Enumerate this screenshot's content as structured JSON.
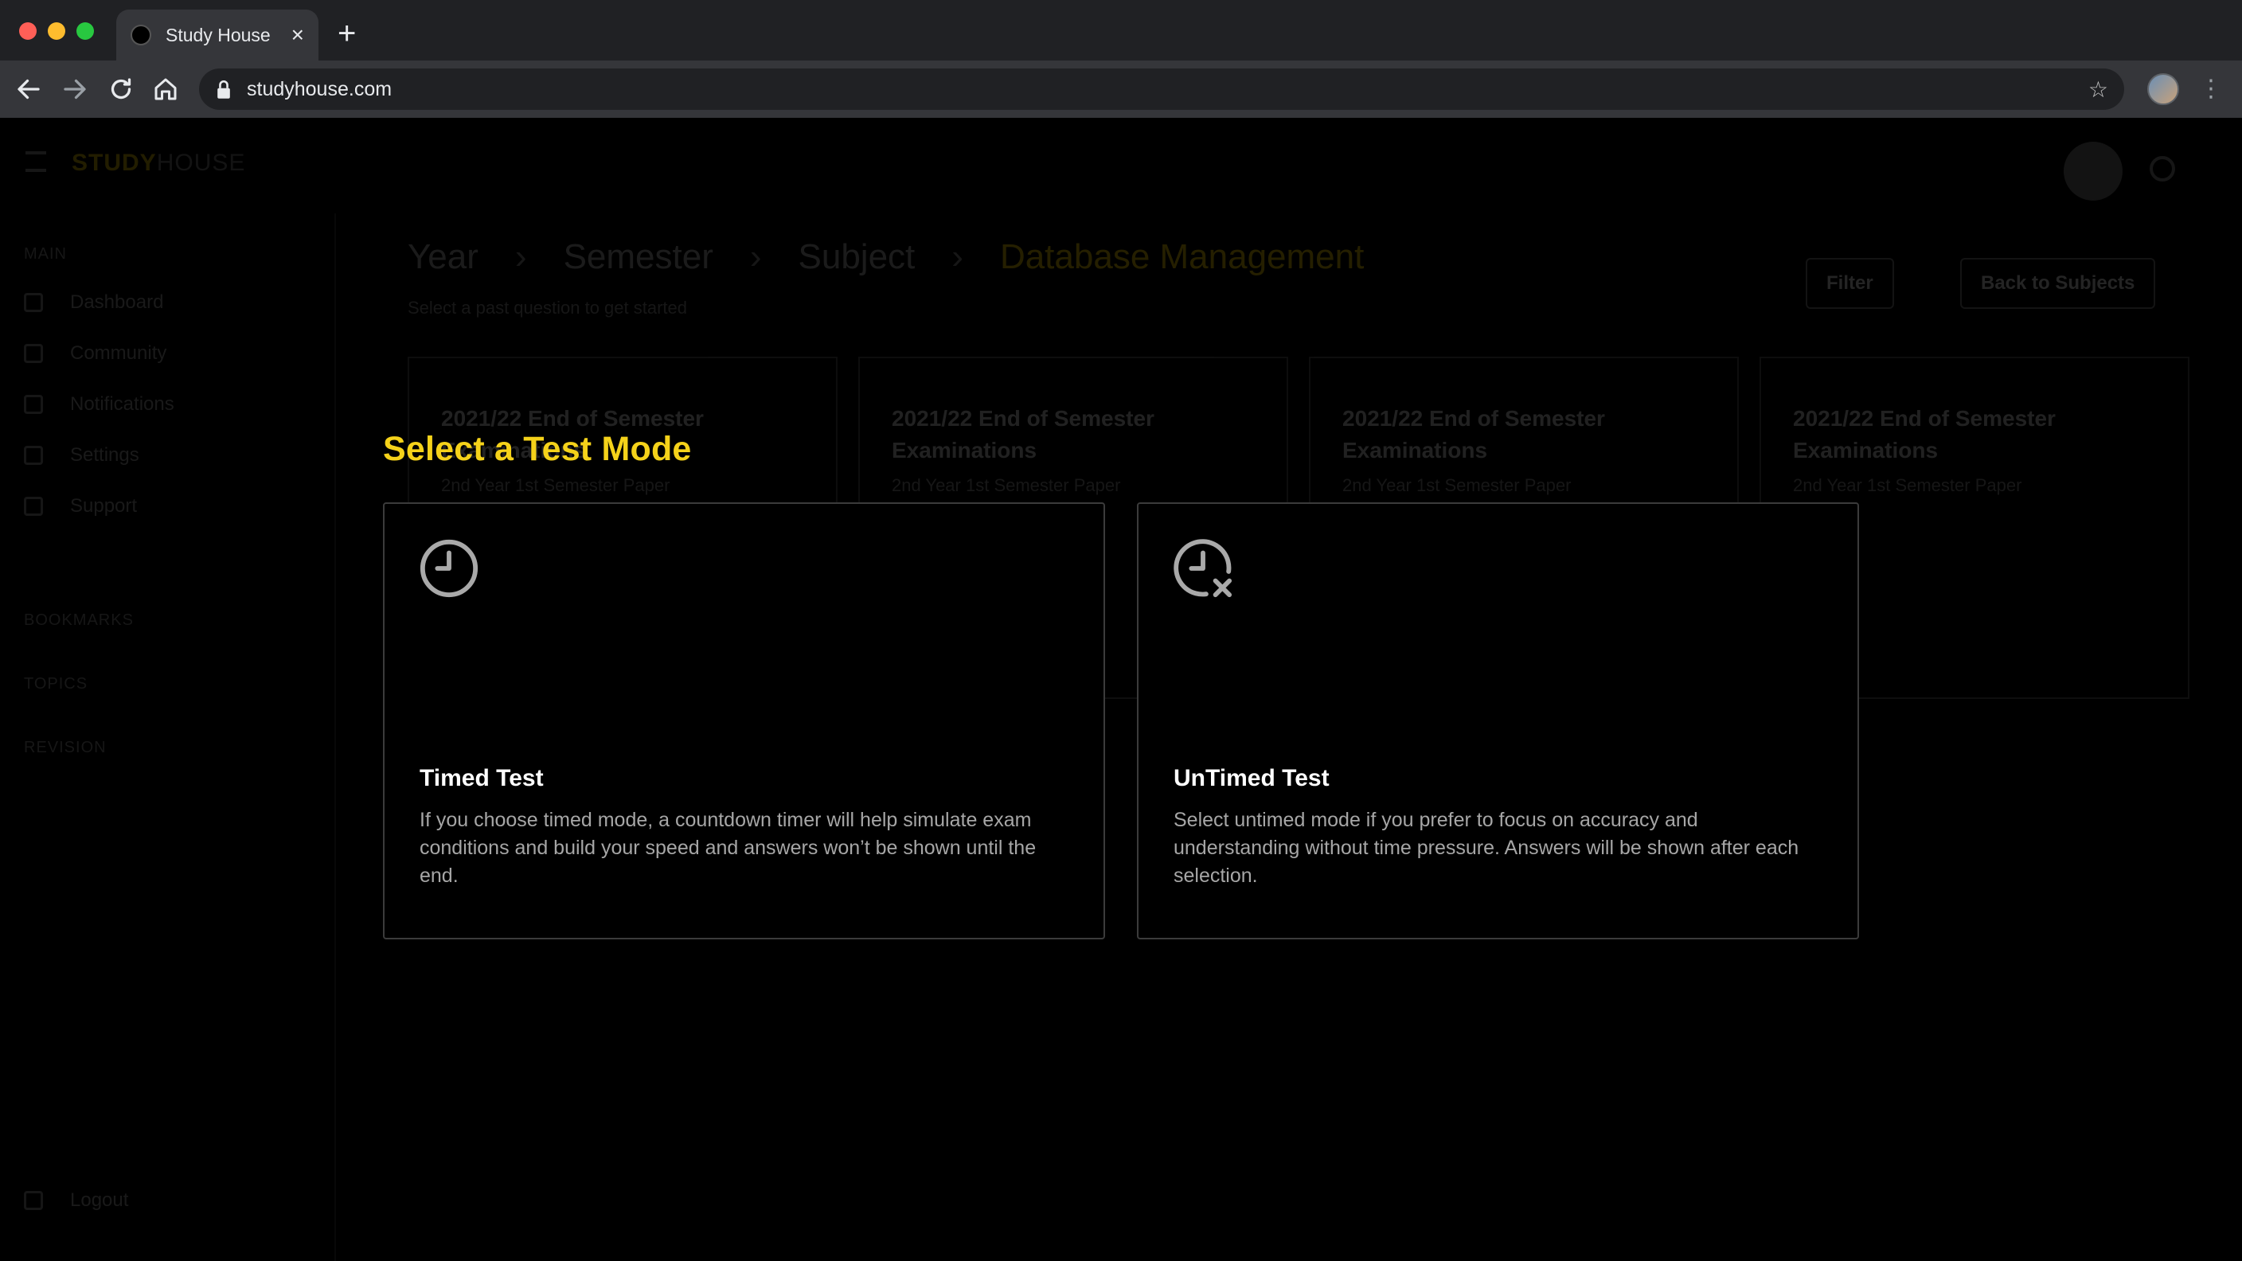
{
  "browser": {
    "tab_title": "Study House",
    "url": "studyhouse.com"
  },
  "background": {
    "logo_bold": "STUDY",
    "logo_rest": "HOUSE",
    "menu_section": "MAIN",
    "nav_items": [
      "Dashboard",
      "Community",
      "Notifications",
      "Settings",
      "Support"
    ],
    "groups": [
      "BOOKMARKS",
      "TOPICS",
      "REVISION"
    ],
    "logout": "Logout",
    "breadcrumbs": [
      "Year",
      "Semester",
      "Subject",
      "Database Management"
    ],
    "subtitle": "Select a past question to get started",
    "filter_button": "Filter",
    "back_button": "Back to Subjects",
    "cards": [
      {
        "title": "2021/22 End of Semester Examinations",
        "meta": "2nd Year 1st Semester Paper"
      },
      {
        "title": "2021/22 End of Semester Examinations",
        "meta": "2nd Year 1st Semester Paper"
      },
      {
        "title": "2021/22 End of Semester Examinations",
        "meta": "2nd Year 1st Semester Paper"
      },
      {
        "title": "2021/22 End of Semester Examinations",
        "meta": "2nd Year 1st Semester Paper"
      }
    ]
  },
  "modal": {
    "title": "Select a Test Mode",
    "options": [
      {
        "icon": "clock-icon",
        "name": "Timed Test",
        "description": "If you choose timed mode, a countdown timer will help simulate exam conditions and build your speed and answers won’t be shown until the end."
      },
      {
        "icon": "clock-cancel-icon",
        "name": "UnTimed Test",
        "description": "Select untimed mode if you prefer to focus on accuracy and understanding without time pressure. Answers will be shown after each selection."
      }
    ]
  },
  "colors": {
    "accent": "#f5d21a",
    "card_border": "#3b3b3b",
    "text_muted": "#a6a6a6",
    "chrome_dark": "#202124",
    "chrome_toolbar": "#35363a"
  }
}
